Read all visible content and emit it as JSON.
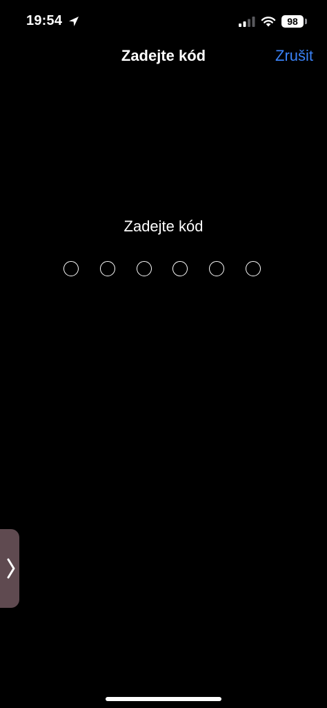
{
  "status_bar": {
    "time": "19:54",
    "battery": "98",
    "icons": [
      "location-arrow-icon",
      "cellular-signal-icon",
      "wifi-icon",
      "battery-icon"
    ]
  },
  "nav": {
    "title": "Zadejte kód",
    "cancel_label": "Zrušit"
  },
  "passcode": {
    "prompt": "Zadejte kód",
    "digits_total": 6,
    "digits_entered": 0
  },
  "colors": {
    "background": "#000000",
    "accent": "#3a82f7",
    "text": "#ffffff",
    "side_handle": "#5f4a50"
  },
  "side_handle": {
    "icon": "chevron-right-icon"
  }
}
